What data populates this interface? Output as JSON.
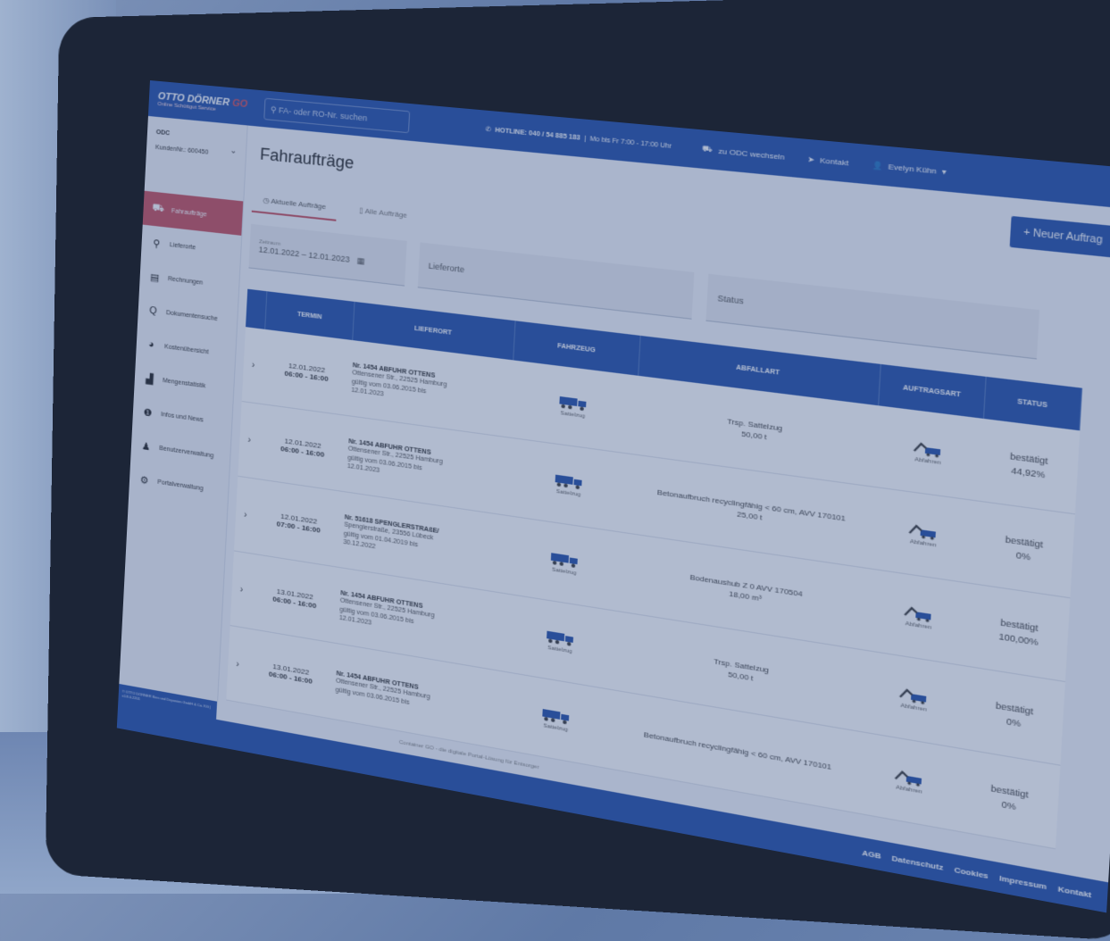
{
  "header": {
    "logo_main": "OTTO DÖRNER",
    "logo_go": "GO",
    "logo_sub": "Online Schüttgut Service",
    "search_placeholder": "FA- oder RO-Nr. suchen",
    "hotline": "HOTLINE: 040 / 54 885 183",
    "hours": "Mo bis Fr 7:00 - 17:00 Uhr",
    "switch_label": "zu ODC wechseln",
    "contact_label": "Kontakt",
    "user_name": "Evelyn Kühn"
  },
  "sidebar": {
    "org_name": "ODC",
    "customer_no": "KundenNr.: 600450",
    "items": [
      {
        "label": "Fahraufträge",
        "icon": "truck-icon",
        "active": true
      },
      {
        "label": "Lieferorte",
        "icon": "map-pin-icon",
        "active": false
      },
      {
        "label": "Rechnungen",
        "icon": "invoice-icon",
        "active": false
      },
      {
        "label": "Dokumentensuche",
        "icon": "search-icon",
        "active": false
      },
      {
        "label": "Kostenübersicht",
        "icon": "pie-chart-icon",
        "active": false
      },
      {
        "label": "Mengenstatistik",
        "icon": "statistic-icon",
        "active": false
      },
      {
        "label": "Infos und News",
        "icon": "info-icon",
        "active": false
      },
      {
        "label": "Benutzerverwaltung",
        "icon": "user-icon",
        "active": false
      },
      {
        "label": "Portalverwaltung",
        "icon": "gear-icon",
        "active": false
      }
    ]
  },
  "main": {
    "title": "Fahraufträge",
    "new_button": "+ Neuer Auftrag",
    "tabs": [
      "Aktuelle Aufträge",
      "Alle Aufträge"
    ],
    "filter_date_label": "Zeitraum",
    "filter_date_value": "12.01.2022 – 12.01.2023",
    "filter_lieferorte": "Lieferorte",
    "filter_status": "Status"
  },
  "table": {
    "headers": [
      "TERMIN",
      "LIEFERORT",
      "FAHRZEUG",
      "ABFALLART",
      "AUFTRAGSART",
      "STATUS"
    ],
    "rows": [
      {
        "date": "12.01.2022",
        "time": "06:00 - 16:00",
        "loc_title": "Nr. 1454 ABFUHR OTTENS",
        "loc_addr": "Ottensener Str., 22525 Hamburg",
        "loc_valid": "gültig vom 03.06.2015 bis",
        "loc_end": "12.01.2023",
        "vehicle": "Sattelzug",
        "waste": "Trsp. Sattelzug",
        "amount": "50,00 t",
        "order_type": "Abfahren",
        "status": "bestätigt",
        "percent": "44,92%"
      },
      {
        "date": "12.01.2022",
        "time": "06:00 - 16:00",
        "loc_title": "Nr. 1454 ABFUHR OTTENS",
        "loc_addr": "Ottensener Str., 22525 Hamburg",
        "loc_valid": "gültig vom 03.06.2015 bis",
        "loc_end": "12.01.2023",
        "vehicle": "Sattelzug",
        "waste": "Betonaufbruch recyclingfähig < 60 cm, AVV 170101",
        "amount": "25,00 t",
        "order_type": "Abfahren",
        "status": "bestätigt",
        "percent": "0%"
      },
      {
        "date": "12.01.2022",
        "time": "07:00 - 16:00",
        "loc_title": "Nr. 51618 SPENGLERSTRAßE/",
        "loc_addr": "Spenglerstraße, 23556 Lübeck",
        "loc_valid": "gültig vom 01.04.2019 bis",
        "loc_end": "30.12.2022",
        "vehicle": "Sattelzug",
        "waste": "Bodenaushub Z 0 AVV 170504",
        "amount": "18,00 m³",
        "order_type": "Abfahren",
        "status": "bestätigt",
        "percent": "100,00%"
      },
      {
        "date": "13.01.2022",
        "time": "06:00 - 16:00",
        "loc_title": "Nr. 1454 ABFUHR OTTENS",
        "loc_addr": "Ottensener Str., 22525 Hamburg",
        "loc_valid": "gültig vom 03.06.2015 bis",
        "loc_end": "12.01.2023",
        "vehicle": "Sattelzug",
        "waste": "Trsp. Sattelzug",
        "amount": "50,00 t",
        "order_type": "Abfahren",
        "status": "bestätigt",
        "percent": "0%"
      },
      {
        "date": "13.01.2022",
        "time": "06:00 - 16:00",
        "loc_title": "Nr. 1454 ABFUHR OTTENS",
        "loc_addr": "Ottensener Str., 22525 Hamburg",
        "loc_valid": "gültig vom 03.06.2015 bis",
        "loc_end": "",
        "vehicle": "Sattelzug",
        "waste": "Betonaufbruch recyclingfähig < 60 cm, AVV 170101",
        "amount": "",
        "order_type": "Abfahren",
        "status": "bestätigt",
        "percent": "0%"
      }
    ]
  },
  "footer": {
    "copyright": "© OTTO DÖRNER Kies und Deponien GmbH & Co. KG | v1.8.0.2201",
    "tagline": "Container GO - die digitale Portal-Lösung für Entsorger",
    "links": [
      "AGB",
      "Datenschutz",
      "Cookies",
      "Impressum",
      "Kontakt"
    ]
  },
  "colors": {
    "brand_blue": "#1e50b8",
    "accent_red": "#d94b5a"
  }
}
